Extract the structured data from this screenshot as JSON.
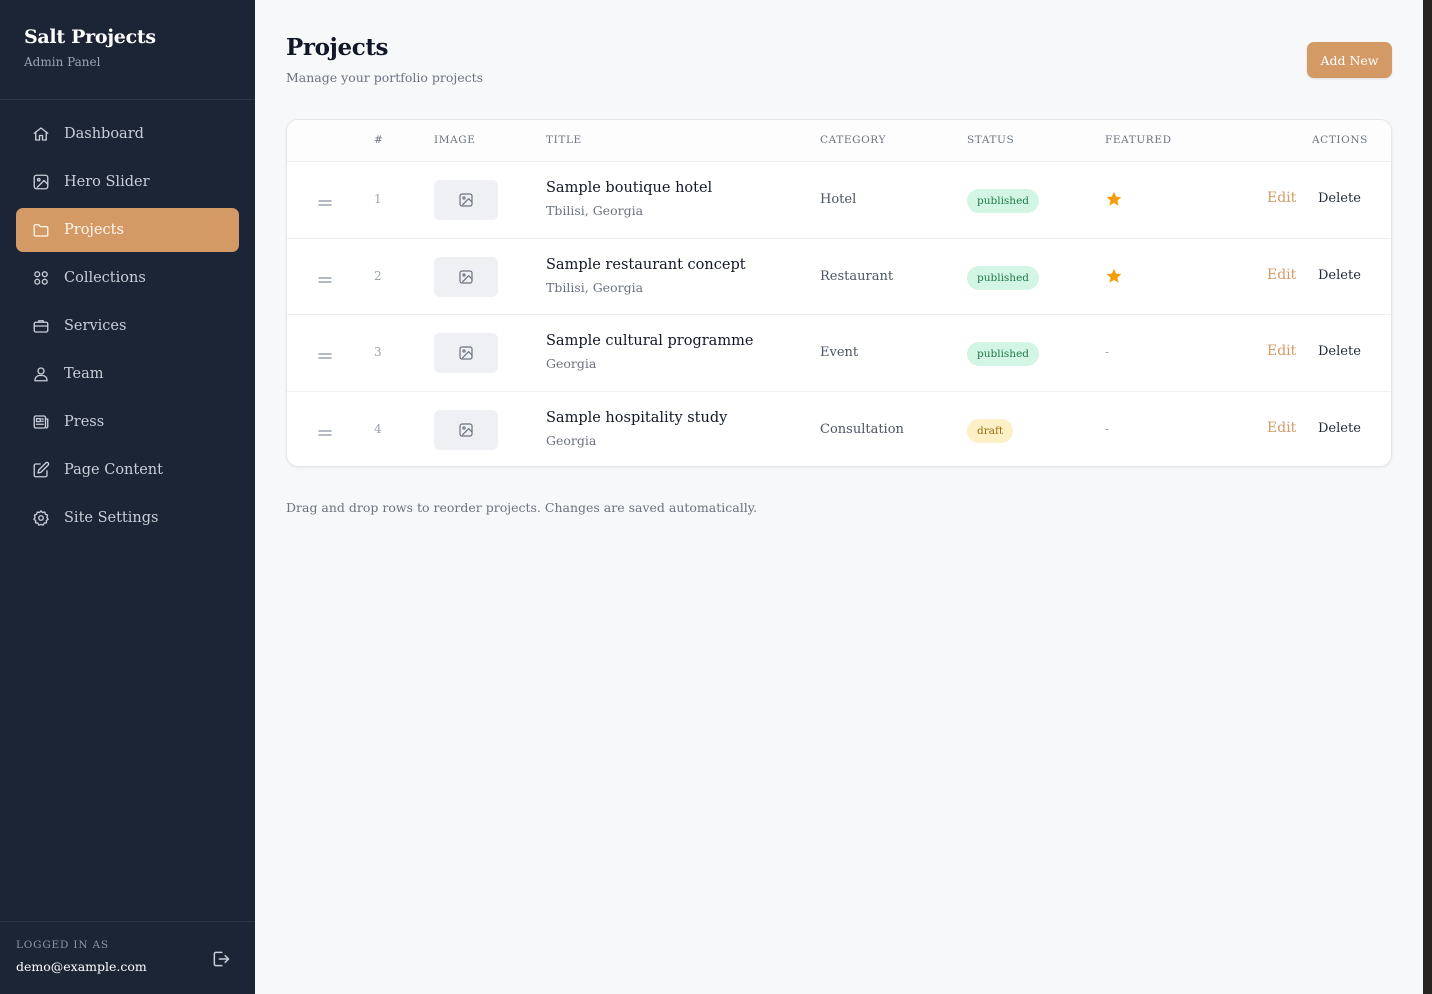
{
  "sidebar": {
    "brand_title": "Salt Projects",
    "brand_subtitle": "Admin Panel",
    "items": [
      {
        "label": "Dashboard",
        "icon": "home-icon"
      },
      {
        "label": "Hero Slider",
        "icon": "image-icon"
      },
      {
        "label": "Projects",
        "icon": "folder-icon",
        "active": true
      },
      {
        "label": "Collections",
        "icon": "grid-icon"
      },
      {
        "label": "Services",
        "icon": "briefcase-icon"
      },
      {
        "label": "Team",
        "icon": "users-icon"
      },
      {
        "label": "Press",
        "icon": "newspaper-icon"
      },
      {
        "label": "Page Content",
        "icon": "edit-icon"
      },
      {
        "label": "Site Settings",
        "icon": "gear-icon"
      }
    ],
    "footer": {
      "logged_in_label": "LOGGED IN AS",
      "email": "demo@example.com"
    }
  },
  "header": {
    "title": "Projects",
    "subtitle": "Manage your portfolio projects",
    "add_button": "Add New"
  },
  "table": {
    "columns": {
      "num": "#",
      "image": "IMAGE",
      "title": "TITLE",
      "category": "CATEGORY",
      "status": "STATUS",
      "featured": "FEATURED",
      "actions": "ACTIONS"
    },
    "rows": [
      {
        "num": "1",
        "title": "Sample boutique hotel",
        "location": "Tbilisi, Georgia",
        "category": "Hotel",
        "status": "published",
        "featured": true,
        "edit": "Edit",
        "delete": "Delete"
      },
      {
        "num": "2",
        "title": "Sample restaurant concept",
        "location": "Tbilisi, Georgia",
        "category": "Restaurant",
        "status": "published",
        "featured": true,
        "edit": "Edit",
        "delete": "Delete"
      },
      {
        "num": "3",
        "title": "Sample cultural programme",
        "location": "Georgia",
        "category": "Event",
        "status": "published",
        "featured": false,
        "featured_text": "-",
        "edit": "Edit",
        "delete": "Delete"
      },
      {
        "num": "4",
        "title": "Sample hospitality study",
        "location": "Georgia",
        "category": "Consultation",
        "status": "draft",
        "featured": false,
        "featured_text": "-",
        "edit": "Edit",
        "delete": "Delete"
      }
    ]
  },
  "hint": "Drag and drop rows to reorder projects. Changes are saved automatically.",
  "colors": {
    "sidebar_bg": "#1c2536",
    "accent": "#d49a66",
    "published_bg": "#d3f5e3",
    "draft_bg": "#fdf0c6",
    "star": "#f59e0b"
  }
}
